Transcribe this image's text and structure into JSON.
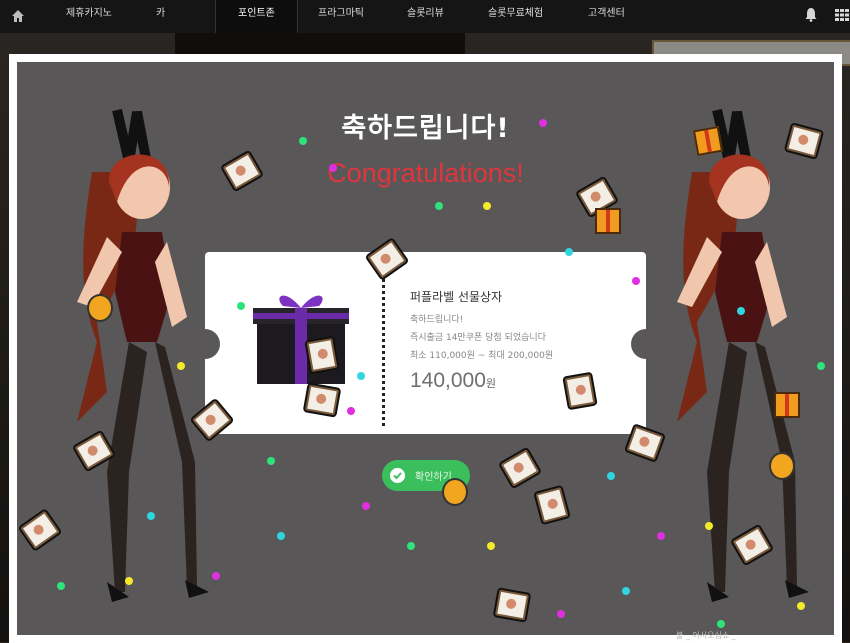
{
  "nav": {
    "items": [
      {
        "label": "제휴카지노"
      },
      {
        "label": "카"
      },
      {
        "label": "포인트존",
        "active": true
      },
      {
        "label": "프라그마틱"
      },
      {
        "label": "슬롯리뷰"
      },
      {
        "label": "슬롯무료체험"
      },
      {
        "label": "고객센터"
      }
    ]
  },
  "modal": {
    "title_kr": "축하드립니다!",
    "title_en": "Congratulations!",
    "coupon": {
      "name": "퍼플라벨 선물상자",
      "line1": "축하드립니다!",
      "line2": "즉시출금 14만쿠폰 당첨 되었습니다",
      "line3": "최소 110,000원 ~ 최대 200,000원",
      "amount": "140,000",
      "unit": "원"
    },
    "confirm_label": "확인하기"
  },
  "background": {
    "note": "불 _ 어서오십쇼 _"
  },
  "colors": {
    "accent_title_en": "#e0353d",
    "confirm_button": "#3bbf5c",
    "modal_bg": "#595757",
    "gift_purple": "#6b2ba8"
  },
  "icons": [
    "home-icon",
    "bell-icon",
    "grid-icon",
    "gift-box-icon",
    "check-icon",
    "money-icon",
    "money-bag-icon",
    "confetti"
  ]
}
